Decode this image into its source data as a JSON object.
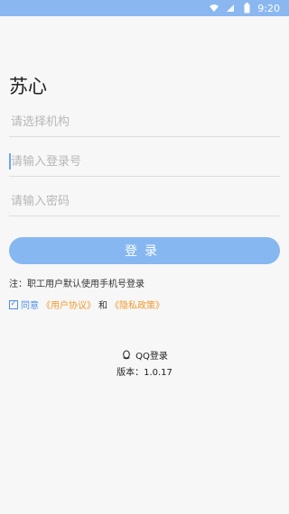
{
  "status_bar": {
    "time": "9:20",
    "icons": [
      "wifi-icon",
      "signal-icon",
      "battery-icon"
    ]
  },
  "app_title": "苏心",
  "fields": {
    "org": {
      "placeholder": "请选择机构"
    },
    "account": {
      "placeholder": "请输入登录号"
    },
    "password": {
      "placeholder": "请输入密码"
    }
  },
  "login_button": {
    "label": "登录"
  },
  "note": "注：职工用户默认使用手机号登录",
  "agreement": {
    "checkbox_checked": true,
    "agree_text": "同意",
    "user_agreement": "《用户协议》",
    "and": "和",
    "privacy_policy": "《隐私政策》"
  },
  "qq_login": {
    "label": "QQ登录"
  },
  "version": "版本：1.0.17",
  "colors": {
    "status_bar": "#8ab7ef",
    "login_button": "#86b7f1",
    "link_blue": "#4c8fe6",
    "link_orange": "#f29a2e"
  }
}
